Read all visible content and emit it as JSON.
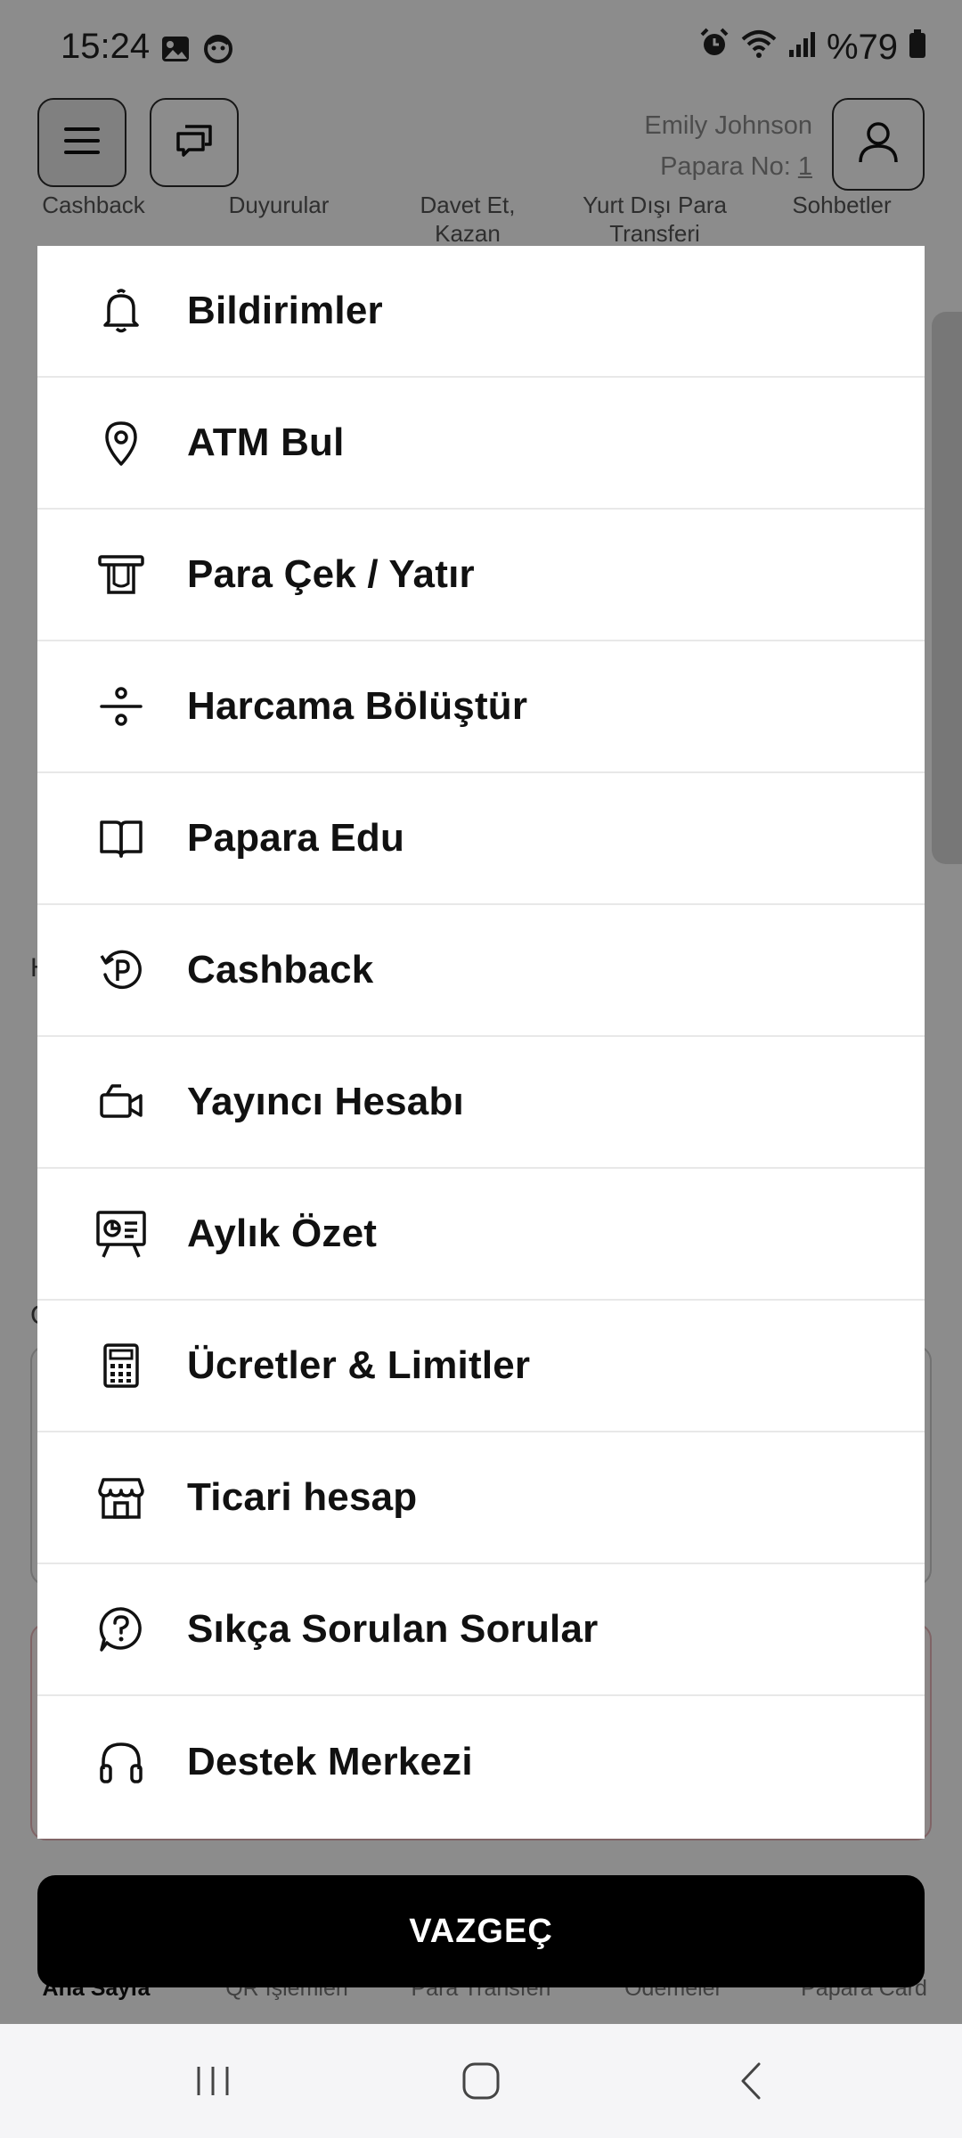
{
  "status_bar": {
    "time": "15:24",
    "battery": "%79",
    "icons_left": [
      "gallery-icon",
      "face-icon"
    ],
    "icons_right": [
      "alarm-icon",
      "wifi-icon",
      "signal-icon",
      "battery-icon"
    ]
  },
  "header": {
    "user_name": "Emily Johnson",
    "papara_no_label": "Papara No:",
    "papara_no_value": "1"
  },
  "background": {
    "shortcut_labels": [
      "Cashback",
      "Duyurular",
      "Davet Et,\nKazan",
      "Yurt Dışı Para\nTransferi",
      "Sohbetler"
    ],
    "side_texts": [
      "H",
      "C"
    ],
    "bottom_tabs": [
      "Ana Sayfa",
      "QR İşlemleri",
      "Para Transferi",
      "Ödemeler",
      "Papara Card"
    ]
  },
  "menu": {
    "items": [
      {
        "label": "Bildirimler",
        "icon": "bell-icon"
      },
      {
        "label": "ATM Bul",
        "icon": "location-pin-icon"
      },
      {
        "label": "Para Çek / Yatır",
        "icon": "atm-icon"
      },
      {
        "label": "Harcama Bölüştür",
        "icon": "divide-icon"
      },
      {
        "label": "Papara Edu",
        "icon": "book-icon"
      },
      {
        "label": "Cashback",
        "icon": "cashback-icon"
      },
      {
        "label": "Yayıncı Hesabı",
        "icon": "video-camera-icon"
      },
      {
        "label": "Aylık Özet",
        "icon": "presentation-icon"
      },
      {
        "label": "Ücretler & Limitler",
        "icon": "calculator-icon"
      },
      {
        "label": "Ticari hesap",
        "icon": "store-icon"
      },
      {
        "label": "Sıkça Sorulan Sorular",
        "icon": "question-bubble-icon"
      },
      {
        "label": "Destek Merkezi",
        "icon": "headphones-icon"
      }
    ]
  },
  "cancel_button": {
    "label": "VAZGEÇ"
  },
  "nav_bar": {
    "icons": [
      "recent-apps-icon",
      "home-icon",
      "back-icon"
    ]
  }
}
